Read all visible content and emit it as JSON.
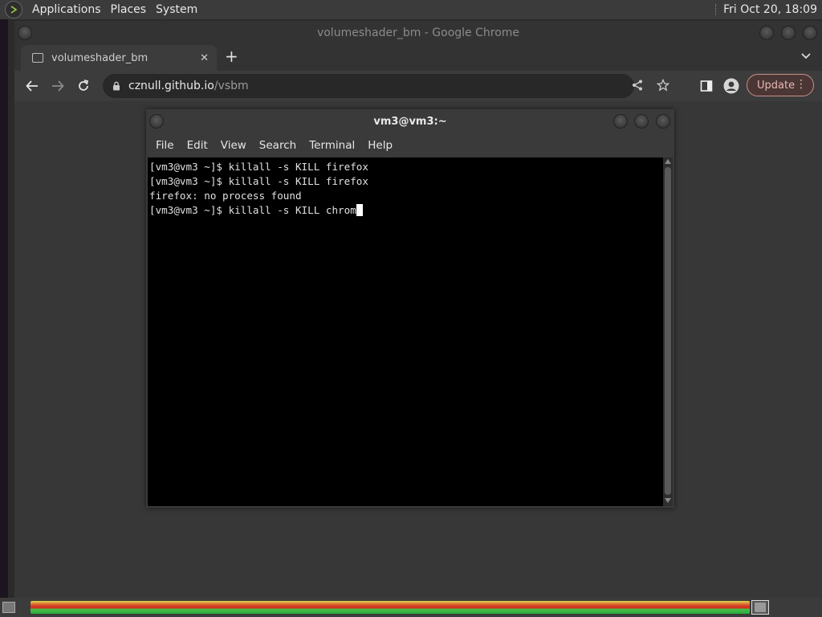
{
  "top_panel": {
    "menus": [
      "Applications",
      "Places",
      "System"
    ],
    "clock": "Fri Oct 20, 18:09"
  },
  "chrome": {
    "window_title": "volumeshader_bm - Google Chrome",
    "tab_title": "volumeshader_bm",
    "tab_close": "✕",
    "new_tab": "+",
    "url_host": "cznull.github.io",
    "url_path": "/vsbm",
    "update_label": "Update",
    "update_menu": "⋮",
    "tab_list": "⌄"
  },
  "terminal": {
    "title": "vm3@vm3:~",
    "menus": [
      "File",
      "Edit",
      "View",
      "Search",
      "Terminal",
      "Help"
    ],
    "lines": [
      "[vm3@vm3 ~]$ killall -s KILL firefox",
      "[vm3@vm3 ~]$ killall -s KILL firefox",
      "firefox: no process found",
      "[vm3@vm3 ~]$ killall -s KILL chrom"
    ]
  },
  "colors": {
    "update_border": "#c9908b",
    "terminal_bg": "#000000"
  }
}
